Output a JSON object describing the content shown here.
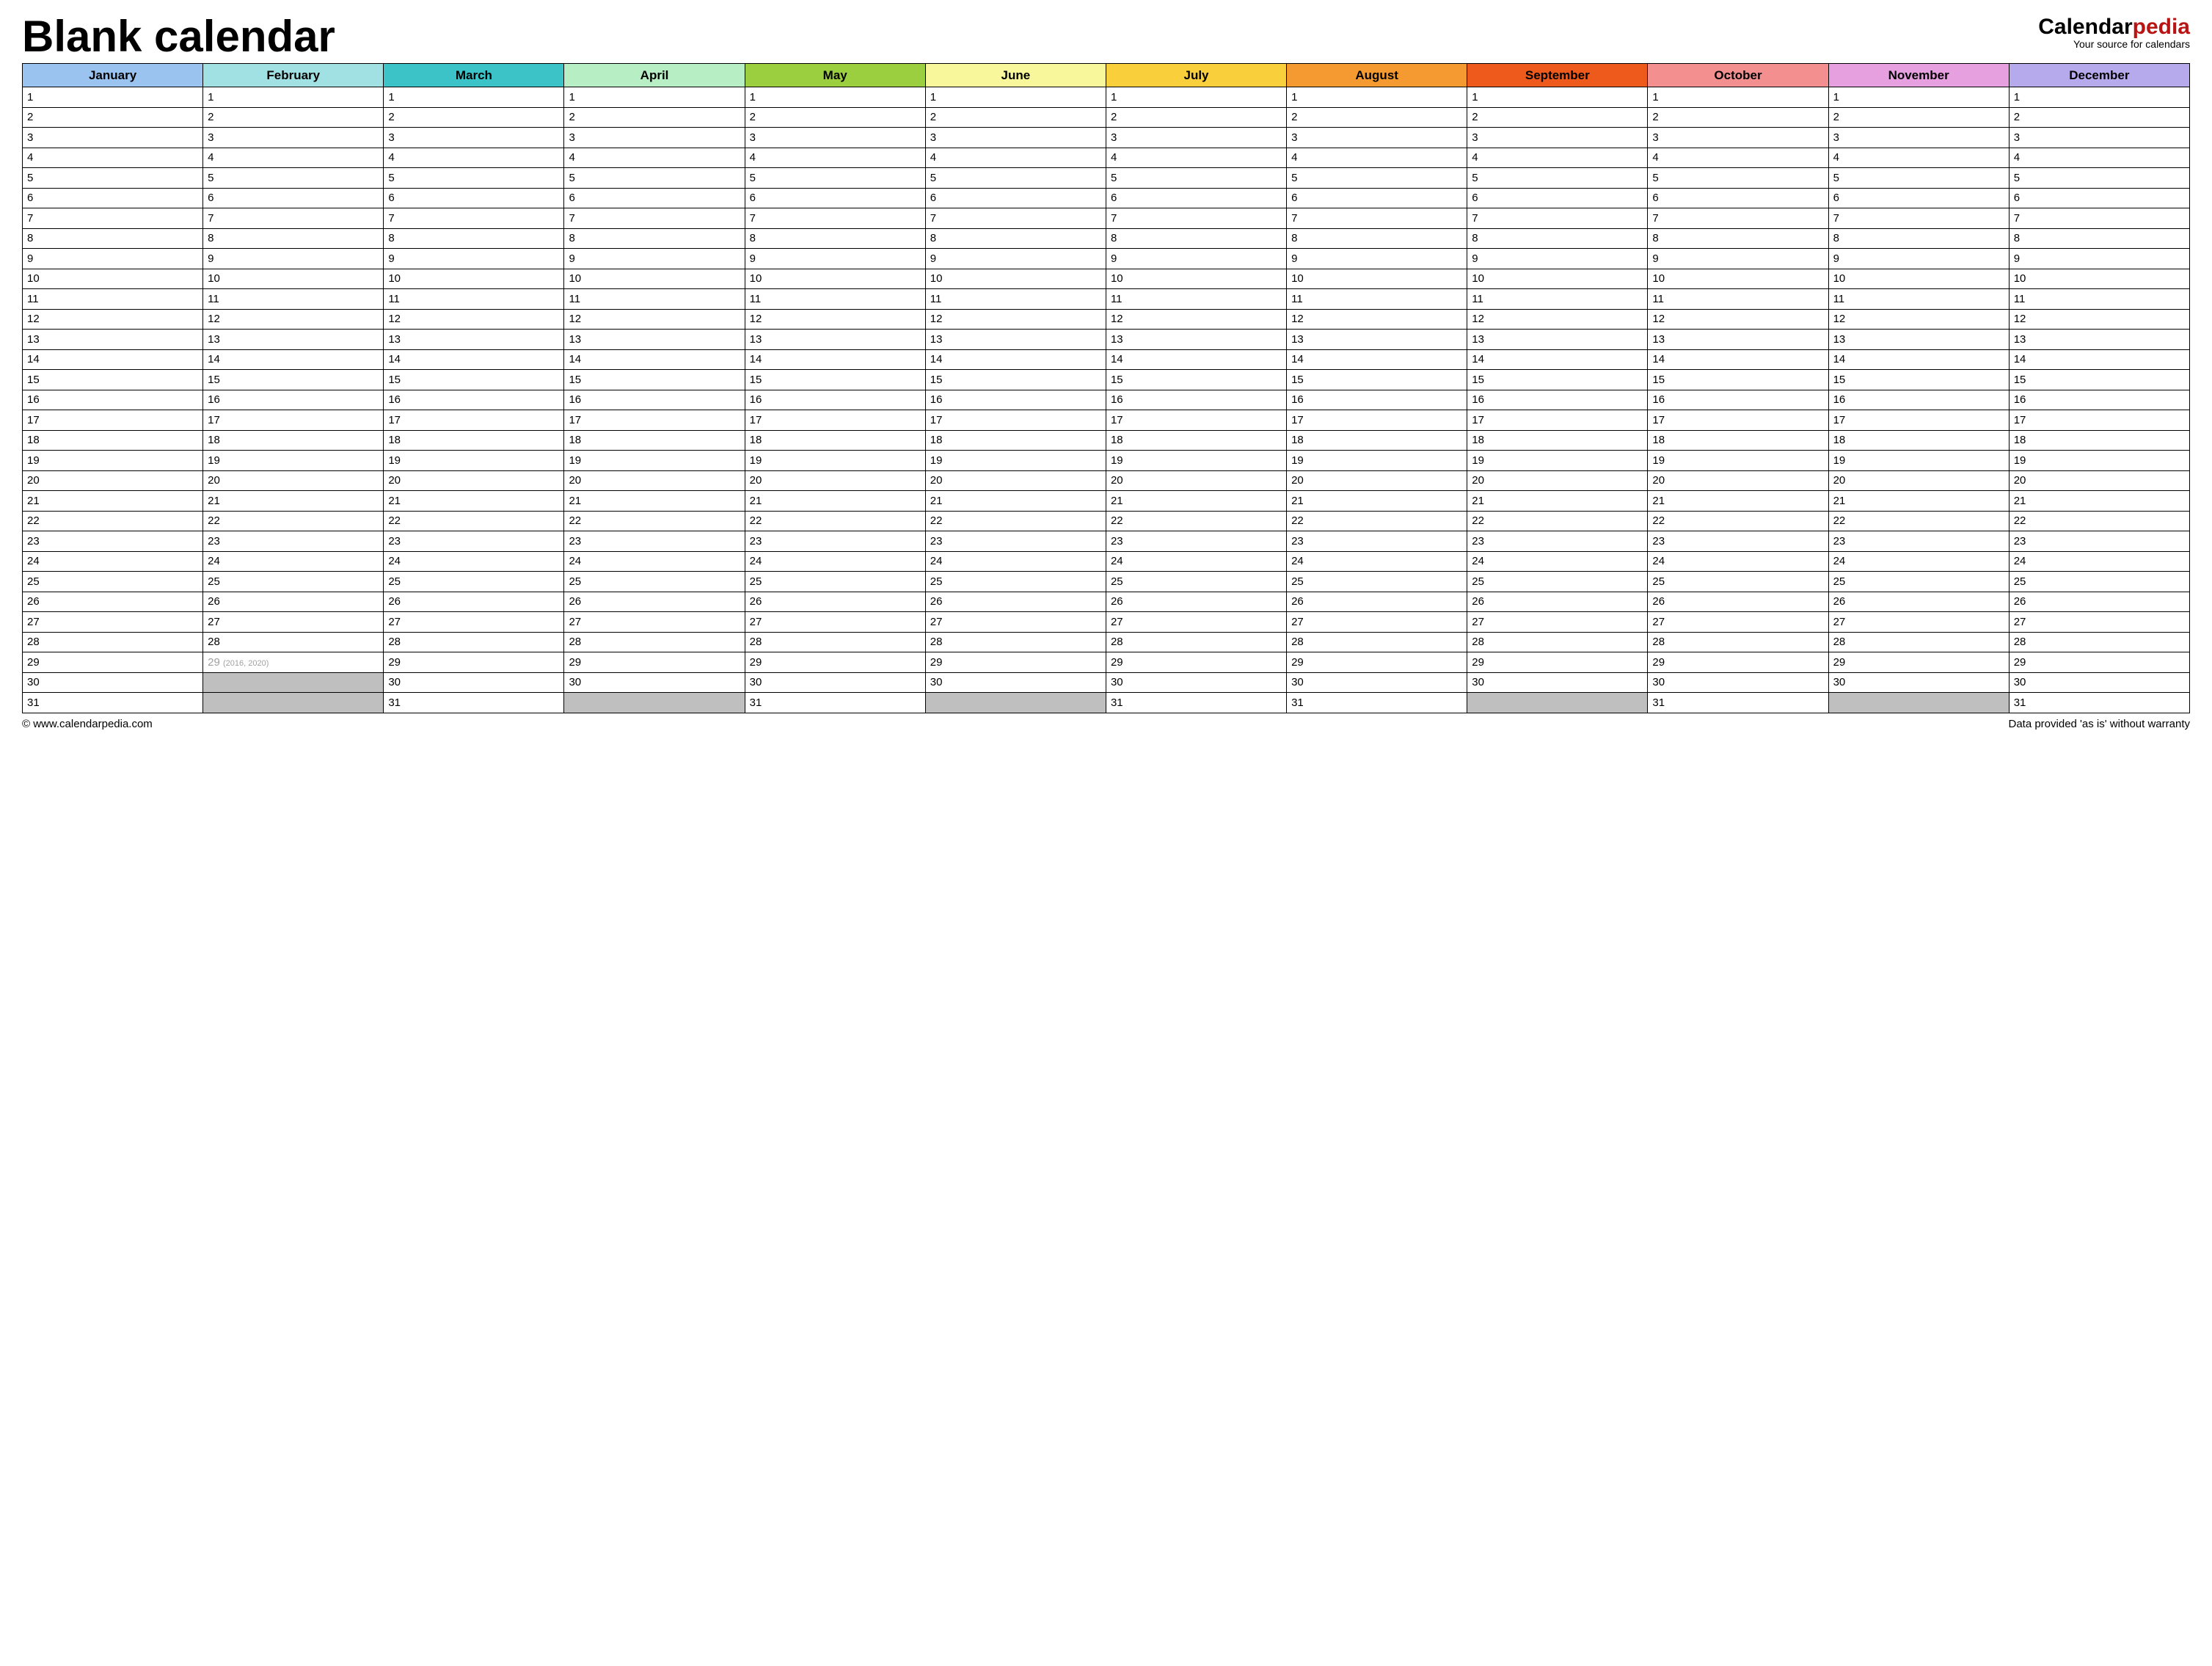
{
  "header": {
    "title": "Blank calendar",
    "brand_prefix": "Calendar",
    "brand_accent": "pedia",
    "brand_tagline": "Your source for calendars"
  },
  "months": [
    {
      "name": "January",
      "color": "#9bc3f0",
      "days": 31
    },
    {
      "name": "February",
      "color": "#a1e1e4",
      "days": 28,
      "leap_day": 29,
      "leap_note": "(2016, 2020)"
    },
    {
      "name": "March",
      "color": "#3cc3c8",
      "days": 31
    },
    {
      "name": "April",
      "color": "#b7eec3",
      "days": 30
    },
    {
      "name": "May",
      "color": "#9bcf3f",
      "days": 31
    },
    {
      "name": "June",
      "color": "#f8f79c",
      "days": 30
    },
    {
      "name": "July",
      "color": "#f9cf3c",
      "days": 31
    },
    {
      "name": "August",
      "color": "#f59a30",
      "days": 31
    },
    {
      "name": "September",
      "color": "#ed5a1c",
      "days": 30
    },
    {
      "name": "October",
      "color": "#f48f8f",
      "days": 31
    },
    {
      "name": "November",
      "color": "#e6a0e0",
      "days": 30
    },
    {
      "name": "December",
      "color": "#b6a9ec",
      "days": 31
    }
  ],
  "max_rows": 31,
  "footer": {
    "copyright": "© www.calendarpedia.com",
    "disclaimer": "Data provided 'as is' without warranty"
  }
}
